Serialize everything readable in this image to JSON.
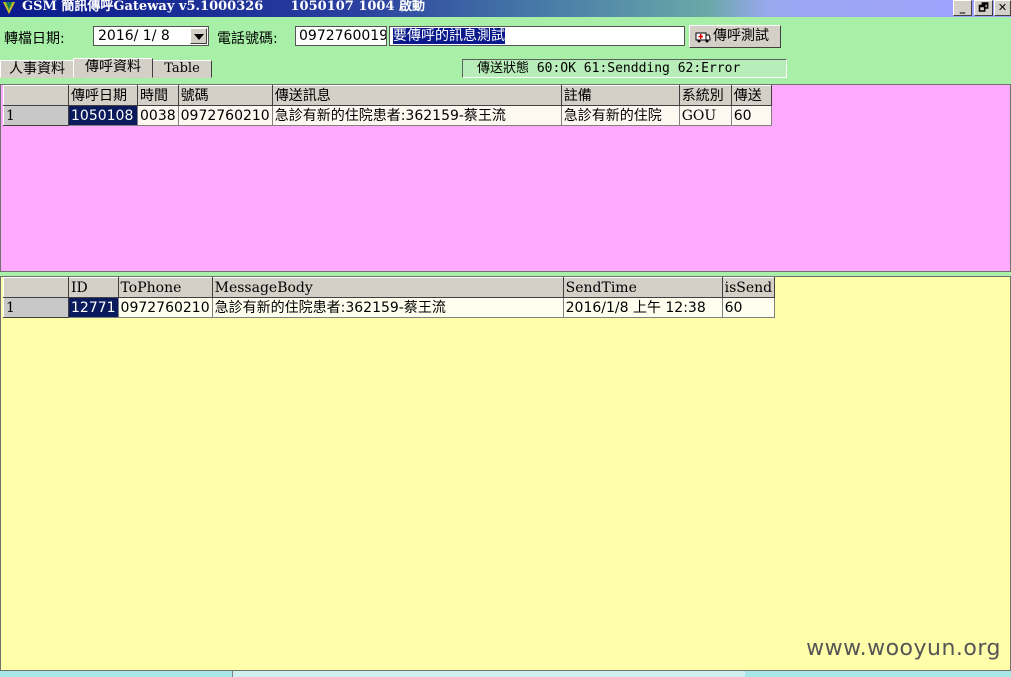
{
  "window": {
    "title": "GSM 簡訊傳呼Gateway v5.1000326      1050107 1004 啟動",
    "min_label": "_",
    "restore_label": "🗗",
    "close_label": "✕"
  },
  "toolbar": {
    "date_label": "轉檔日期:",
    "date_value": "2016/ 1/ 8",
    "phone_label": "電話號碼:",
    "phone_value": "0972760019",
    "message_value": "要傳呼的訊息測試",
    "test_button_label": "傳呼測試"
  },
  "tabs": [
    {
      "label": "人事資料"
    },
    {
      "label": "傳呼資料"
    },
    {
      "label": "Table"
    }
  ],
  "status_text": "傳送狀態 60:OK  61:Sendding  62:Error",
  "grid1": {
    "columns": [
      "傳呼日期",
      "時間",
      "號碼",
      "傳送訊息",
      "註備",
      "系統別",
      "傳送"
    ],
    "rows": [
      {
        "index": "1",
        "cells": [
          "1050108",
          "0038",
          "0972760210",
          "急診有新的住院患者:362159-蔡王流",
          "急診有新的住院",
          "GOU",
          "60"
        ]
      }
    ]
  },
  "grid2": {
    "columns": [
      "ID",
      "ToPhone",
      "MessageBody",
      "SendTime",
      "isSend"
    ],
    "rows": [
      {
        "index": "1",
        "cells": [
          "12771",
          "0972760210",
          "急診有新的住院患者:362159-蔡王流",
          "2016/1/8 上午 12:38",
          "60"
        ]
      }
    ]
  },
  "watermark": "www.wooyun.org",
  "colors": {
    "background": "#a8f0a8",
    "grid1_bg": "#ffaaff",
    "grid2_bg": "#ffffaa",
    "selection": "#0a1a5c"
  }
}
